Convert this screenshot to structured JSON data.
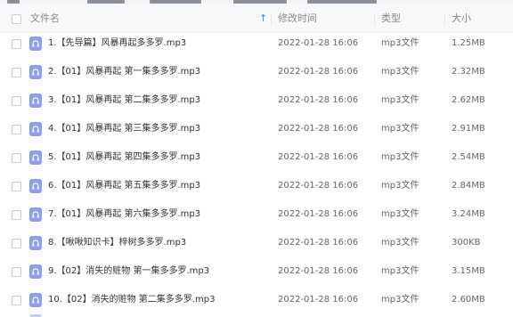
{
  "header": {
    "name_label": "文件名",
    "sort_arrow": "↑",
    "time_label": "修改时间",
    "type_label": "类型",
    "size_label": "大小"
  },
  "files": [
    {
      "name": "1.【先导篇】风暴再起多多罗.mp3",
      "time": "2022-01-28 16:06",
      "type": "mp3文件",
      "size": "1.25MB"
    },
    {
      "name": "2.【01】风暴再起 第一集多多罗.mp3",
      "time": "2022-01-28 16:06",
      "type": "mp3文件",
      "size": "2.32MB"
    },
    {
      "name": "3.【01】风暴再起 第二集多多罗.mp3",
      "time": "2022-01-28 16:06",
      "type": "mp3文件",
      "size": "2.62MB"
    },
    {
      "name": "4.【01】风暴再起 第三集多多罗.mp3",
      "time": "2022-01-28 16:06",
      "type": "mp3文件",
      "size": "2.91MB"
    },
    {
      "name": "5.【01】风暴再起 第四集多多罗.mp3",
      "time": "2022-01-28 16:06",
      "type": "mp3文件",
      "size": "2.54MB"
    },
    {
      "name": "6.【01】风暴再起 第五集多多罗.mp3",
      "time": "2022-01-28 16:06",
      "type": "mp3文件",
      "size": "2.84MB"
    },
    {
      "name": "7.【01】风暴再起 第六集多多罗.mp3",
      "time": "2022-01-28 16:06",
      "type": "mp3文件",
      "size": "3.24MB"
    },
    {
      "name": "8.【啾啾知识卡】梓树多多罗.mp3",
      "time": "2022-01-28 16:06",
      "type": "mp3文件",
      "size": "300KB"
    },
    {
      "name": "9.【02】消失的赃物 第一集多多罗.mp3",
      "time": "2022-01-28 16:06",
      "type": "mp3文件",
      "size": "3.15MB"
    },
    {
      "name": "10.【02】消失的赃物 第二集多多罗.mp3",
      "time": "2022-01-28 16:06",
      "type": "mp3文件",
      "size": "2.60MB"
    }
  ],
  "icons": {
    "file_icon": "audio-file-icon",
    "accent": "#8e9cf5",
    "sort_color": "#2f8cf0"
  }
}
